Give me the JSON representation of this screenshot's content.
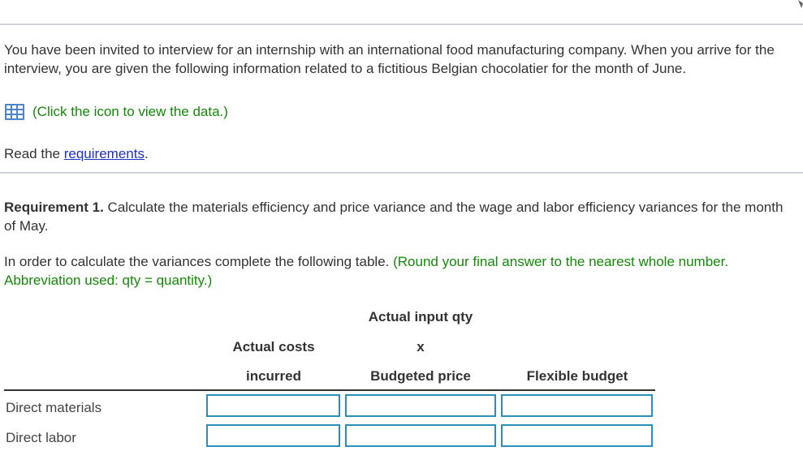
{
  "intro": {
    "text": "You have been invited to interview for an internship with an international food manufacturing company. When you arrive for the interview, you are given the following information related to a fictitious Belgian chocolatier for the month of June."
  },
  "data_link": {
    "icon": "grid-icon",
    "label": "(Click the icon to view the data.)"
  },
  "read_requirements": {
    "prefix": "Read the ",
    "link": "requirements",
    "suffix": "."
  },
  "requirement1": {
    "label": "Requirement 1.",
    "text": " Calculate the materials efficiency and price variance and the wage and labor efficiency variances for the month of May."
  },
  "instruction": {
    "text": "In order to calculate the variances complete the following table. ",
    "hint": "(Round your final answer to the nearest whole number. Abbreviation used: qty = quantity.)"
  },
  "table": {
    "headers": {
      "actual_input_qty": "Actual input qty",
      "actual_costs": "Actual costs",
      "x": "x",
      "incurred": "incurred",
      "budgeted_price": "Budgeted price",
      "flexible_budget": "Flexible budget"
    },
    "rows": [
      {
        "label": "Direct materials",
        "values": [
          "",
          "",
          ""
        ]
      },
      {
        "label": "Direct labor",
        "values": [
          "",
          "",
          ""
        ]
      }
    ]
  },
  "colors": {
    "hint_green": "#138a07",
    "link_blue": "#1c2fc4",
    "input_border": "#2a8fbd"
  }
}
